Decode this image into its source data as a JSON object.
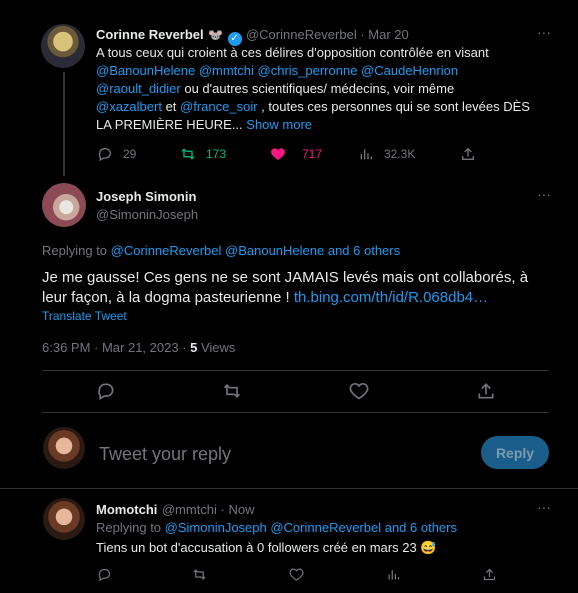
{
  "tweet1": {
    "name": "Corinne Reverbel",
    "badge_emoji": "🐭",
    "handle_date": "@CorinneReverbel · Mar 20",
    "line1": "A tous ceux qui croient à ces délires d'opposition contrôlée en visant",
    "line2_mentions": "@BanounHelene @mmtchi @chris_perronne @CaudeHenrion",
    "line3_mention": "@raoult_didier",
    "line3_text": " ou d'autres scientifiques/ médecins, voir même",
    "line4_mention1": "@xazalbert",
    "line4_mid": " et ",
    "line4_mention2": "@france_soir",
    "line4_text": " , toutes ces personnes qui se sont levées DÈS",
    "line5_text": "LA PREMIÈRE HEURE...",
    "show_more": "Show more",
    "replies": "29",
    "retweets": "173",
    "likes": "717",
    "views": "32.3K"
  },
  "tweet2": {
    "name": "Joseph Simonin",
    "handle": "@SimoninJoseph",
    "replying_label": "Replying to ",
    "replying_mentions": "@CorinneReverbel @BanounHelene and 6 others",
    "text_line1": "Je me gausse! Ces gens ne se sont JAMAIS levés mais ont collaborés, à",
    "text_line2": "leur façon, à la dogma pasteurienne ! ",
    "link": "th.bing.com/th/id/R.068db4…",
    "translate": "Translate Tweet",
    "time": "6:36 PM · Mar 21, 2023 · ",
    "views_count": "5",
    "views_label": " Views"
  },
  "compose": {
    "placeholder": "Tweet your reply",
    "reply_button": "Reply"
  },
  "tweet3": {
    "name": "Momotchi",
    "handle_date": "@mmtchi · Now",
    "replying_label": "Replying to ",
    "replying_mentions": "@SimoninJoseph @CorinneReverbel and 6 others",
    "text": "Tiens un bot d'accusation à 0 followers créé en mars 23 ",
    "emoji": "😅"
  },
  "colors": {
    "accent": "#1d9bf0",
    "retweet": "#00ba7c",
    "like": "#f91880"
  }
}
